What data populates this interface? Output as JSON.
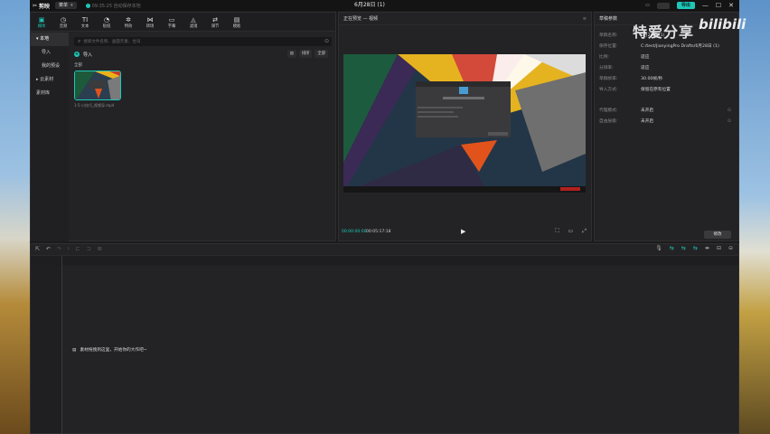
{
  "titlebar": {
    "app_name": "剪映",
    "menu_label": "菜单",
    "autosave": "09:35:25 自动保存本地",
    "doc_title": "6月28日 (1)",
    "export_label": "导出",
    "controls": [
      "—",
      "☐",
      "✕"
    ]
  },
  "toolbar": {
    "tools": [
      {
        "icon": "play-square-icon",
        "label": "媒体",
        "glyph": "▣"
      },
      {
        "icon": "audio-icon",
        "label": "音频",
        "glyph": "◷"
      },
      {
        "icon": "text-icon",
        "label": "文本",
        "glyph": "TI"
      },
      {
        "icon": "sticker-icon",
        "label": "贴纸",
        "glyph": "◔"
      },
      {
        "icon": "effects-icon",
        "label": "特效",
        "glyph": "✲"
      },
      {
        "icon": "transition-icon",
        "label": "转场",
        "glyph": "⋈"
      },
      {
        "icon": "caption-icon",
        "label": "字幕",
        "glyph": "▭"
      },
      {
        "icon": "filter-icon",
        "label": "滤镜",
        "glyph": "◬"
      },
      {
        "icon": "adjust-icon",
        "label": "调节",
        "glyph": "⇄"
      },
      {
        "icon": "template-icon",
        "label": "模板",
        "glyph": "▤"
      }
    ]
  },
  "sidenav": {
    "items": [
      "本地",
      "导入",
      "我的预设",
      "云素材",
      "素材库"
    ]
  },
  "media": {
    "search_placeholder": "搜索文件名称、画面元素、台词",
    "import_label": "导入",
    "filter_view": "▤",
    "filter_sort": "排序",
    "filter_all": "全部",
    "section": "全部",
    "clip_name": "1-5-小技巧_视频导.mp4"
  },
  "preview": {
    "header": "正在预览 — 视频",
    "time_current": "00:00:00:00",
    "time_total": "00:05:17:18"
  },
  "props": {
    "header": "草稿参数",
    "rows": [
      {
        "k": "草稿名称:",
        "v": "6月28日 (1)"
      },
      {
        "k": "保存位置:",
        "v": "C:/test/JianyingPro Drafts/6月28日 (1)"
      },
      {
        "k": "比例:",
        "v": "适应"
      },
      {
        "k": "分辨率:",
        "v": "适应"
      },
      {
        "k": "草稿帧率:",
        "v": "30.00帧/秒"
      },
      {
        "k": "导入方式:",
        "v": "保留在原有位置"
      },
      {
        "k": "代理模式:",
        "v": "未开启"
      },
      {
        "k": "自由层级:",
        "v": "未开启"
      }
    ],
    "edit_label": "修改"
  },
  "timeline": {
    "drop_hint": "素材拖拽到这里，开始你的大作吧~"
  },
  "watermark": {
    "text": "特爱分享",
    "logo": "bilibili"
  },
  "colors": {
    "accent": "#1fc7b8",
    "bg": "#1b1b1c",
    "panel": "#232325"
  }
}
